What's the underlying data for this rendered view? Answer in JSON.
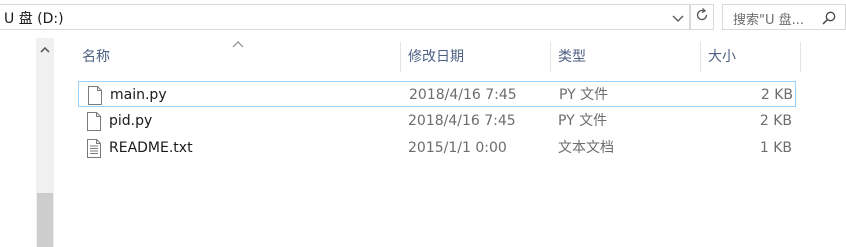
{
  "address": {
    "path": "U 盘 (D:)"
  },
  "search": {
    "placeholder": "搜索\"U 盘..."
  },
  "columns": {
    "name": "名称",
    "date": "修改日期",
    "type": "类型",
    "size": "大小"
  },
  "files": [
    {
      "name": "main.py",
      "date": "2018/4/16 7:45",
      "type": "PY 文件",
      "size": "2 KB",
      "icon": "python-file-icon",
      "selected": true
    },
    {
      "name": "pid.py",
      "date": "2018/4/16 7:45",
      "type": "PY 文件",
      "size": "2 KB",
      "icon": "python-file-icon",
      "selected": false
    },
    {
      "name": "README.txt",
      "date": "2015/1/1 0:00",
      "type": "文本文档",
      "size": "1 KB",
      "icon": "text-file-icon",
      "selected": false
    }
  ],
  "colors": {
    "header_text": "#4d6082",
    "selection_border": "#99d1ff",
    "muted_text": "#6d6d6d"
  }
}
